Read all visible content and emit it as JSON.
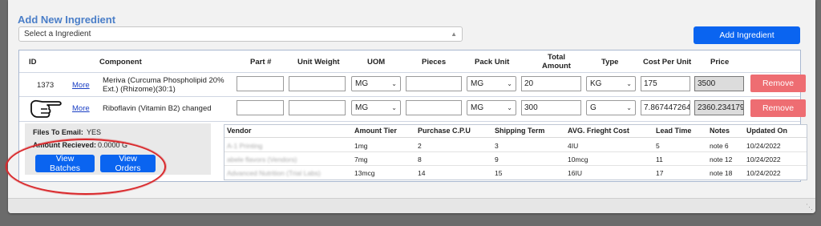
{
  "form": {
    "title": "Add New Ingredient",
    "select_placeholder": "Select a Ingredient",
    "add_button": "Add Ingredient"
  },
  "table": {
    "headers": {
      "id": "ID",
      "component": "Component",
      "part": "Part #",
      "unit_weight": "Unit Weight",
      "uom": "UOM",
      "pieces": "Pieces",
      "pack_unit": "Pack Unit",
      "total_amount_1": "Total",
      "total_amount_2": "Amount",
      "type": "Type",
      "cost_per_unit": "Cost Per Unit",
      "price": "Price"
    },
    "rows": [
      {
        "id": "1373",
        "more": "More",
        "component": "Meriva (Curcuma Phospholipid 20% Ext.) (Rhizome)(30:1)",
        "part": "",
        "unit_weight": "",
        "uom": "MG",
        "pieces": "",
        "pack_unit": "MG",
        "total_amount": "20",
        "type": "KG",
        "cost_per_unit": "175",
        "price": "3500",
        "remove": "Remove"
      },
      {
        "id": "",
        "more": "More",
        "component": "Riboflavin (Vitamin B2) changed",
        "part": "",
        "unit_weight": "",
        "uom": "MG",
        "pieces": "",
        "pack_unit": "MG",
        "total_amount": "300",
        "type": "G",
        "cost_per_unit": "7.867447264",
        "price": "2360.234179",
        "remove": "Remove"
      }
    ]
  },
  "details": {
    "files_to_email_label": "Files To Email:",
    "files_to_email_value": "YES",
    "amount_received_label": "Amount Recieved:",
    "amount_received_value": "0.0000 G",
    "view_batches": "View Batches",
    "view_orders": "View Orders"
  },
  "vendors": {
    "headers": {
      "vendor": "Vendor",
      "amount_tier": "Amount Tier",
      "purchase_cpu": "Purchase C.P.U",
      "shipping_term": "Shipping Term",
      "avg_freight": "AVG. Frieght Cost",
      "lead_time": "Lead Time",
      "notes": "Notes",
      "updated_on": "Updated On"
    },
    "rows": [
      {
        "vendor": "A-1 Printing",
        "amount_tier": "1mg",
        "purchase_cpu": "2",
        "shipping_term": "3",
        "avg_freight": "4IU",
        "lead_time": "5",
        "notes": "note 6",
        "updated_on": "10/24/2022"
      },
      {
        "vendor": "abele flavors (Vendors)",
        "amount_tier": "7mg",
        "purchase_cpu": "8",
        "shipping_term": "9",
        "avg_freight": "10mcg",
        "lead_time": "11",
        "notes": "note 12",
        "updated_on": "10/24/2022"
      },
      {
        "vendor": "Advanced Nutrition (Trial Labs)",
        "amount_tier": "13mcg",
        "purchase_cpu": "14",
        "shipping_term": "15",
        "avg_freight": "16IU",
        "lead_time": "17",
        "notes": "note 18",
        "updated_on": "10/24/2022"
      }
    ]
  },
  "colors": {
    "primary_button": "#0a64f0",
    "remove_button": "#ee6d72",
    "title": "#4a7ec8",
    "annotation": "#d9282b"
  },
  "icons": [
    "pointing-hand-icon",
    "chevron-down-icon",
    "resize-grip-icon"
  ]
}
